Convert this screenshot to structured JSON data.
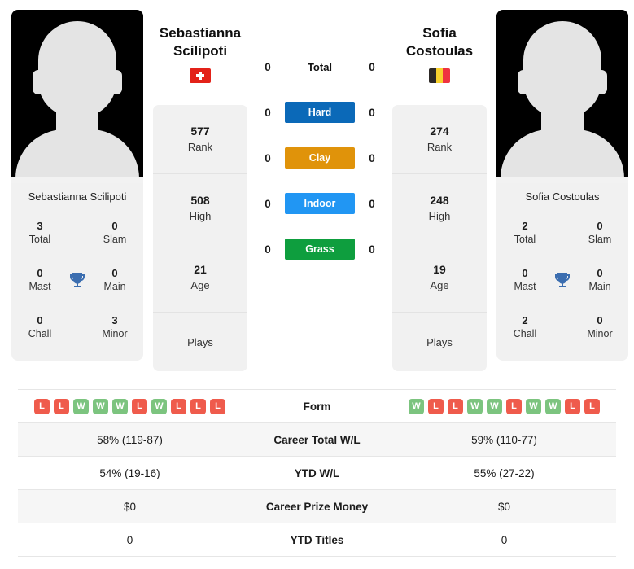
{
  "players": {
    "left": {
      "first_name": "Sebastianna",
      "last_name": "Scilipoti",
      "full_name": "Sebastianna Scilipoti",
      "country_flag": "switzerland-flag",
      "avatar": "player-avatar-placeholder",
      "stats": {
        "rank_value": "577",
        "rank_label": "Rank",
        "high_value": "508",
        "high_label": "High",
        "age_value": "21",
        "age_label": "Age",
        "plays_value": "",
        "plays_label": "Plays"
      },
      "titles": {
        "total_value": "3",
        "total_label": "Total",
        "slam_value": "0",
        "slam_label": "Slam",
        "mast_value": "0",
        "mast_label": "Mast",
        "main_value": "0",
        "main_label": "Main",
        "chall_value": "0",
        "chall_label": "Chall",
        "minor_value": "3",
        "minor_label": "Minor"
      },
      "form": [
        "L",
        "L",
        "W",
        "W",
        "W",
        "L",
        "W",
        "L",
        "L",
        "L"
      ],
      "career_total_wl": "58% (119-87)",
      "ytd_wl": "54% (19-16)",
      "career_prize_money": "$0",
      "ytd_titles": "0"
    },
    "right": {
      "first_name": "Sofia",
      "last_name": "Costoulas",
      "full_name": "Sofia Costoulas",
      "country_flag": "belgium-flag",
      "avatar": "player-avatar-placeholder",
      "stats": {
        "rank_value": "274",
        "rank_label": "Rank",
        "high_value": "248",
        "high_label": "High",
        "age_value": "19",
        "age_label": "Age",
        "plays_value": "",
        "plays_label": "Plays"
      },
      "titles": {
        "total_value": "2",
        "total_label": "Total",
        "slam_value": "0",
        "slam_label": "Slam",
        "mast_value": "0",
        "mast_label": "Mast",
        "main_value": "0",
        "main_label": "Main",
        "chall_value": "2",
        "chall_label": "Chall",
        "minor_value": "0",
        "minor_label": "Minor"
      },
      "form": [
        "W",
        "L",
        "L",
        "W",
        "W",
        "L",
        "W",
        "W",
        "L",
        "L"
      ],
      "career_total_wl": "59% (110-77)",
      "ytd_wl": "55% (27-22)",
      "career_prize_money": "$0",
      "ytd_titles": "0"
    }
  },
  "surfaces": [
    {
      "label": "Total",
      "left": "0",
      "right": "0",
      "color": "",
      "styled": false
    },
    {
      "label": "Hard",
      "left": "0",
      "right": "0",
      "color": "#0b69b8",
      "styled": true
    },
    {
      "label": "Clay",
      "left": "0",
      "right": "0",
      "color": "#e0930a",
      "styled": true
    },
    {
      "label": "Indoor",
      "left": "0",
      "right": "0",
      "color": "#2196f3",
      "styled": true
    },
    {
      "label": "Grass",
      "left": "0",
      "right": "0",
      "color": "#0e9e3e",
      "styled": true
    }
  ],
  "table_rows": [
    {
      "label": "Form",
      "key": "form"
    },
    {
      "label": "Career Total W/L",
      "key": "career_total_wl"
    },
    {
      "label": "YTD W/L",
      "key": "ytd_wl"
    },
    {
      "label": "Career Prize Money",
      "key": "career_prize_money"
    },
    {
      "label": "YTD Titles",
      "key": "ytd_titles"
    }
  ],
  "icons": {
    "trophy": "trophy-icon",
    "trophy_color": "#3c6eb0"
  },
  "colors": {
    "win": "#7cc47f",
    "loss": "#ef5b4c",
    "panel_bg": "#f1f1f1",
    "row_alt_bg": "#f6f6f6"
  }
}
